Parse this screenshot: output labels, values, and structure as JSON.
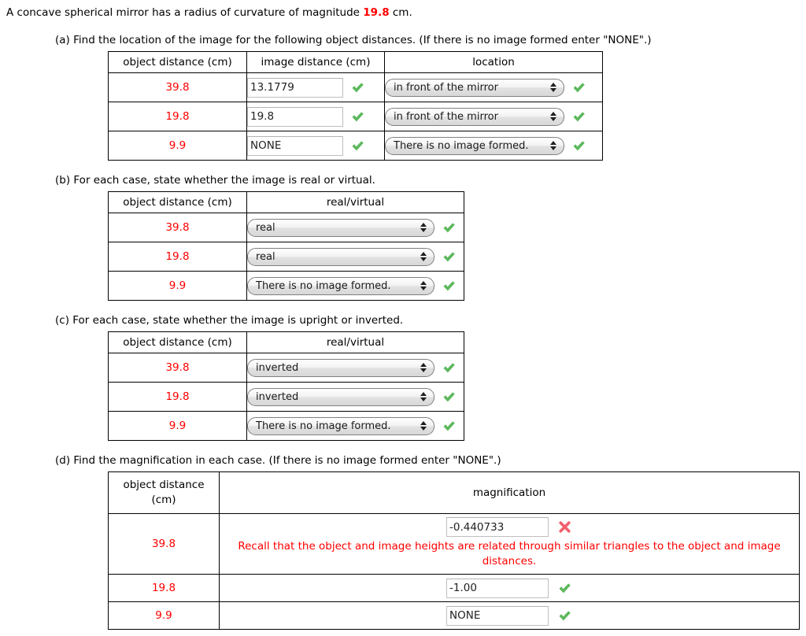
{
  "problem": {
    "stem_before": "A concave spherical mirror has a radius of curvature of magnitude ",
    "stem_value": "19.8",
    "stem_after": " cm."
  },
  "colors": {
    "value_red": "#ff0000",
    "correct_green": "#5cb85c",
    "incorrect_red": "#f4606c",
    "border_black": "#000000"
  },
  "parts": {
    "a": {
      "label": "(a) Find the location of the image for the following object distances. (If there is no image formed enter \"NONE\".)",
      "headers": [
        "object distance (cm)",
        "image distance (cm)",
        "location"
      ],
      "rows": [
        {
          "object_distance": "39.8",
          "image_distance": "13.1779",
          "image_distance_status": "correct",
          "location": "in front of the mirror",
          "location_status": "correct"
        },
        {
          "object_distance": "19.8",
          "image_distance": "19.8",
          "image_distance_status": "correct",
          "location": "in front of the mirror",
          "location_status": "correct"
        },
        {
          "object_distance": "9.9",
          "image_distance": "NONE",
          "image_distance_status": "correct",
          "location": "There is no image formed.",
          "location_status": "correct"
        }
      ]
    },
    "b": {
      "label": "(b) For each case, state whether the image is real or virtual.",
      "headers": [
        "object distance (cm)",
        "real/virtual"
      ],
      "rows": [
        {
          "object_distance": "39.8",
          "answer": "real",
          "status": "correct"
        },
        {
          "object_distance": "19.8",
          "answer": "real",
          "status": "correct"
        },
        {
          "object_distance": "9.9",
          "answer": "There is no image formed.",
          "status": "correct"
        }
      ]
    },
    "c": {
      "label": "(c) For each case, state whether the image is upright or inverted.",
      "headers": [
        "object distance (cm)",
        "real/virtual"
      ],
      "rows": [
        {
          "object_distance": "39.8",
          "answer": "inverted",
          "status": "correct"
        },
        {
          "object_distance": "19.8",
          "answer": "inverted",
          "status": "correct"
        },
        {
          "object_distance": "9.9",
          "answer": "There is no image formed.",
          "status": "correct"
        }
      ]
    },
    "d": {
      "label": "(d) Find the magnification in each case. (If there is no image formed enter \"NONE\".)",
      "headers": [
        "object distance (cm)",
        "magnification"
      ],
      "rows": [
        {
          "object_distance": "39.8",
          "value": "-0.440733",
          "status": "incorrect",
          "feedback": "Recall that the object and image heights are related through similar triangles to the object and image distances."
        },
        {
          "object_distance": "19.8",
          "value": "-1.00",
          "status": "correct",
          "feedback": ""
        },
        {
          "object_distance": "9.9",
          "value": "NONE",
          "status": "correct",
          "feedback": ""
        }
      ]
    }
  }
}
